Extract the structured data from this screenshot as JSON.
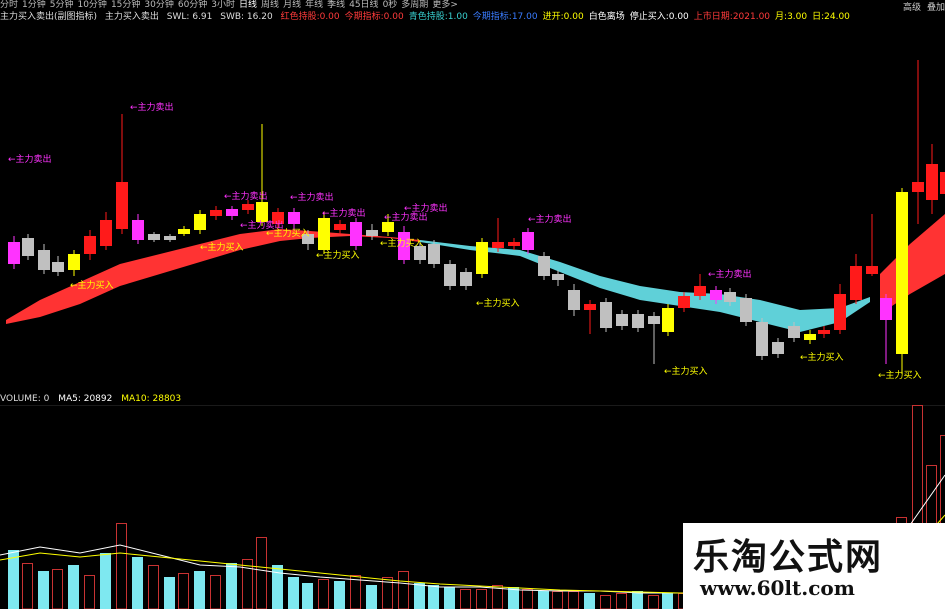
{
  "toolbar": {
    "periods": [
      "分时",
      "1分钟",
      "5分钟",
      "10分钟",
      "15分钟",
      "30分钟",
      "60分钟",
      "3小时",
      "日线",
      "周线",
      "月线",
      "年线",
      "季线",
      "45日线",
      "0秒",
      "多周期",
      "更多>"
    ],
    "active_period": "日线",
    "right_buttons": [
      "高级",
      "叠加"
    ]
  },
  "info": {
    "indicator_name": "主力买入卖出(副图指标)",
    "formula": "主力买入卖出",
    "swl": "SWL: 6.91",
    "swb": "SWB: 16.20",
    "items": [
      {
        "text": "红色持股:0.00",
        "color": "#ff3b3b"
      },
      {
        "text": "今期指标:0.00",
        "color": "#ff3b3b"
      },
      {
        "text": "青色持股:1.00",
        "color": "#39d0d0"
      },
      {
        "text": "今期指标:17.00",
        "color": "#3a7cff"
      },
      {
        "text": "进开:0.00",
        "color": "#ffff00"
      },
      {
        "text": "白色离场",
        "color": "#ffffff"
      },
      {
        "text": "停止买入:0.00",
        "color": "#ffffff"
      },
      {
        "text": "上市日期:2021.00",
        "color": "#ff3b3b"
      },
      {
        "text": "月:3.00",
        "color": "#ffff00"
      },
      {
        "text": "日:24.00",
        "color": "#ffff00"
      }
    ]
  },
  "volume": {
    "label": "VOLUME: 0",
    "ma5": "MA5: 20892",
    "ma10": "MA10: 28803"
  },
  "annotations": {
    "sell": "←主力卖出",
    "buy": "←主力买入"
  },
  "watermark": {
    "line1": "乐淘公式网",
    "line2": "www.60lt.com"
  },
  "colors": {
    "up": "#ff1a1a",
    "down": "#c0c0c0",
    "buy_signal": "#ffff00",
    "sell_signal": "#ff33ff",
    "band_up": "#ff3333",
    "band_down": "#5fd0d8",
    "vol_up": "#7ee8f0",
    "vol_down_outline": "#c83232"
  }
}
